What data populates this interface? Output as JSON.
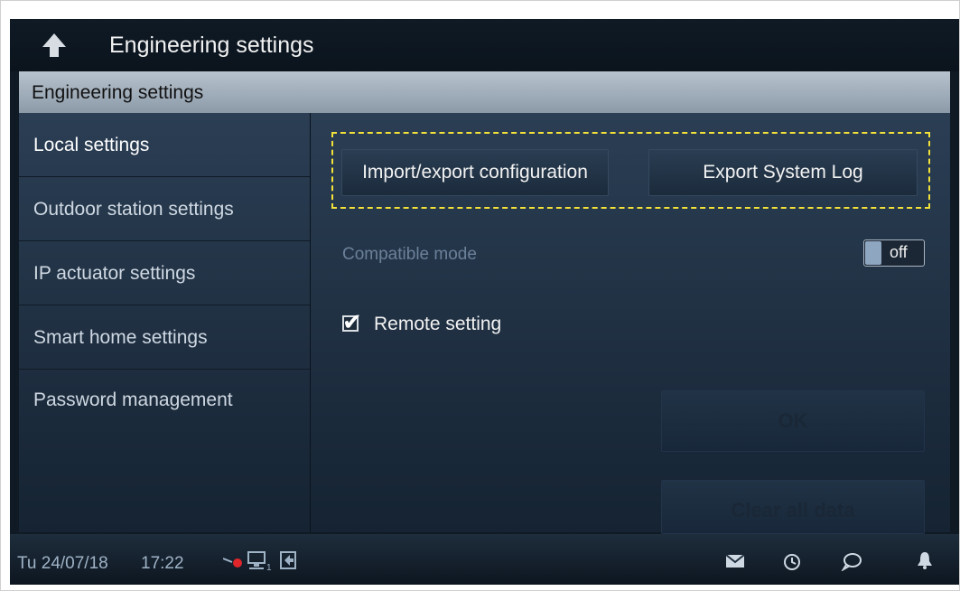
{
  "header": {
    "title": "Engineering settings",
    "back_icon": "back-arrow-icon"
  },
  "subheader": {
    "title": "Engineering settings"
  },
  "sidebar": {
    "items": [
      {
        "label": "Local settings",
        "active": true
      },
      {
        "label": "Outdoor station settings",
        "active": false
      },
      {
        "label": "IP actuator settings",
        "active": false
      },
      {
        "label": "Smart home settings",
        "active": false
      },
      {
        "label": "Password management",
        "active": false
      }
    ]
  },
  "main": {
    "import_export_label": "Import/export configuration",
    "export_log_label": "Export System Log",
    "compatible_mode_label": "Compatible mode",
    "compatible_mode_value": "off",
    "remote_setting_label": "Remote setting",
    "remote_setting_checked": true,
    "ok_label": "OK",
    "clear_label": "Clear all data"
  },
  "statusbar": {
    "date": "Tu 24/07/18",
    "time": "17:22",
    "icons": [
      "camera-recording-icon",
      "network-device-icon",
      "exit-icon",
      "mail-icon",
      "history-icon",
      "chat-icon",
      "bell-icon"
    ]
  },
  "colors": {
    "accent_highlight": "#f3e23a",
    "background": "#152332",
    "recording_dot": "#e0262a"
  }
}
